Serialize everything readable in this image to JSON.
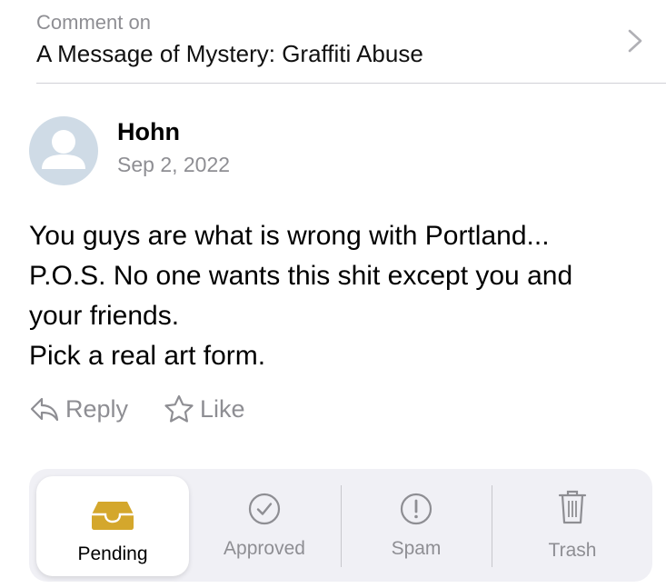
{
  "header": {
    "kicker": "Comment on",
    "post_title": "A Message of Mystery: Graffiti Abuse"
  },
  "comment": {
    "author": "Hohn",
    "date": "Sep 2, 2022",
    "lines": [
      "You guys are what is wrong with Portland...",
      "P.O.S. No one wants this shit except you and",
      "your friends.",
      "Pick a real art form."
    ]
  },
  "actions": {
    "reply_label": "Reply",
    "like_label": "Like"
  },
  "status": {
    "selected": "Pending",
    "options": [
      {
        "label": "Pending",
        "icon": "inbox-tray-icon"
      },
      {
        "label": "Approved",
        "icon": "checkmark-circle-icon"
      },
      {
        "label": "Spam",
        "icon": "exclamation-circle-icon"
      },
      {
        "label": "Trash",
        "icon": "trash-can-icon"
      }
    ]
  },
  "colors": {
    "pending_accent": "#d4a72c",
    "secondary_text": "#8e8e93",
    "avatar_bg": "#cfdbe6",
    "segment_bg": "#f0f0f5"
  }
}
